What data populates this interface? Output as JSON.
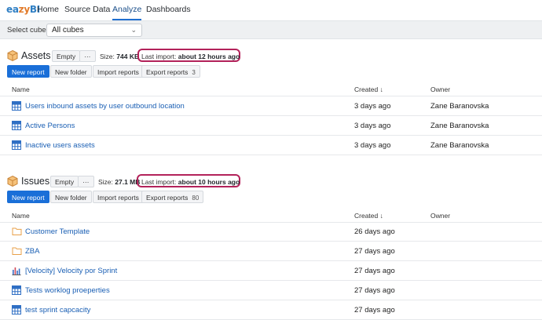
{
  "nav": {
    "logo_a": "ea",
    "logo_b": "zy",
    "logo_c": "BI",
    "items": [
      {
        "label": "Home"
      },
      {
        "label": "Source Data"
      },
      {
        "label": "Analyze"
      },
      {
        "label": "Dashboards"
      }
    ],
    "active": "Analyze"
  },
  "cube_selector": {
    "label": "Select cube:",
    "value": "All cubes"
  },
  "table_headers": {
    "name": "Name",
    "created": "Created ↓",
    "owner": "Owner"
  },
  "cubes": [
    {
      "name": "Assets",
      "empty_label": "Empty",
      "more_label": "···",
      "size_label": "Size:",
      "size_value": "744 KB",
      "import_label": "Last import:",
      "import_value": "about 12 hours ago",
      "new_report": "New report",
      "new_folder": "New folder",
      "import_reports": "Import reports",
      "export_reports": "Export reports",
      "export_count": "3",
      "rows": [
        {
          "icon": "table-icon",
          "name": "Users inbound assets by user outbound location",
          "created": "3 days ago",
          "owner": "Zane Baranovska"
        },
        {
          "icon": "table-icon",
          "name": "Active Persons",
          "created": "3 days ago",
          "owner": "Zane Baranovska"
        },
        {
          "icon": "table-icon",
          "name": "Inactive users assets",
          "created": "3 days ago",
          "owner": "Zane Baranovska"
        }
      ]
    },
    {
      "name": "Issues",
      "empty_label": "Empty",
      "more_label": "···",
      "size_label": "Size:",
      "size_value": "27.1 MB",
      "import_label": "Last import:",
      "import_value": "about 10 hours ago",
      "new_report": "New report",
      "new_folder": "New folder",
      "import_reports": "Import reports",
      "export_reports": "Export reports",
      "export_count": "80",
      "rows": [
        {
          "icon": "folder-icon",
          "name": "Customer Template",
          "created": "26 days ago",
          "owner": ""
        },
        {
          "icon": "folder-icon",
          "name": "ZBA",
          "created": "27 days ago",
          "owner": ""
        },
        {
          "icon": "bar-chart-icon",
          "name": "[Velocity] Velocity por Sprint",
          "created": "27 days ago",
          "owner": ""
        },
        {
          "icon": "table-icon",
          "name": "Tests worklog proeperties",
          "created": "27 days ago",
          "owner": ""
        },
        {
          "icon": "table-icon",
          "name": "test sprint capcacity",
          "created": "27 days ago",
          "owner": ""
        }
      ]
    }
  ],
  "colors": {
    "accent": "#1a6fd8",
    "link": "#1a5fb4",
    "highlight": "#b3225a",
    "folder": "#e8a04a"
  }
}
